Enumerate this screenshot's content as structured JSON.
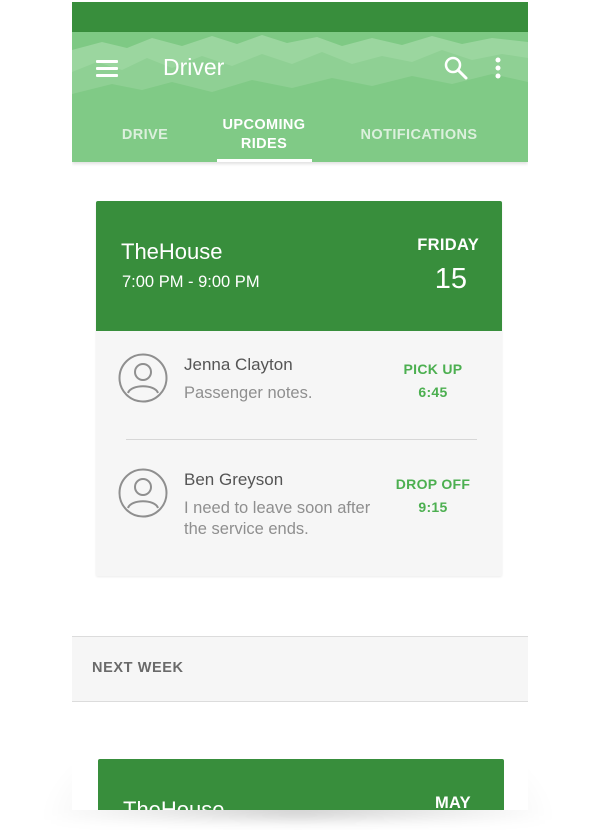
{
  "app": {
    "title": "Driver"
  },
  "tabs": [
    {
      "label": "DRIVE",
      "active": false
    },
    {
      "label": "UPCOMING RIDES",
      "active": true
    },
    {
      "label": "NOTIFICATIONS",
      "active": false
    }
  ],
  "icons": {
    "menu": "menu-icon",
    "search": "search-icon",
    "more": "more-vert-icon",
    "avatar": "account-circle-icon"
  },
  "colors": {
    "status_bar": "#388e3c",
    "app_bar": "#7ec984",
    "card_header": "#388e3c",
    "accent_text": "#4caf50",
    "card_body": "#f6f6f6"
  },
  "ride": {
    "place": "TheHouse",
    "time_range": "7:00 PM - 9:00 PM",
    "day_name": "FRIDAY",
    "day_number": "15",
    "passengers": [
      {
        "name": "Jenna Clayton",
        "notes": "Passenger notes.",
        "action": "PICK UP",
        "time": "6:45"
      },
      {
        "name": "Ben Greyson",
        "notes": "I need to leave soon after the service ends.",
        "action": "DROP OFF",
        "time": "9:15"
      }
    ]
  },
  "next_week": {
    "label": "NEXT WEEK",
    "place": "TheHouse",
    "month": "MAY"
  }
}
